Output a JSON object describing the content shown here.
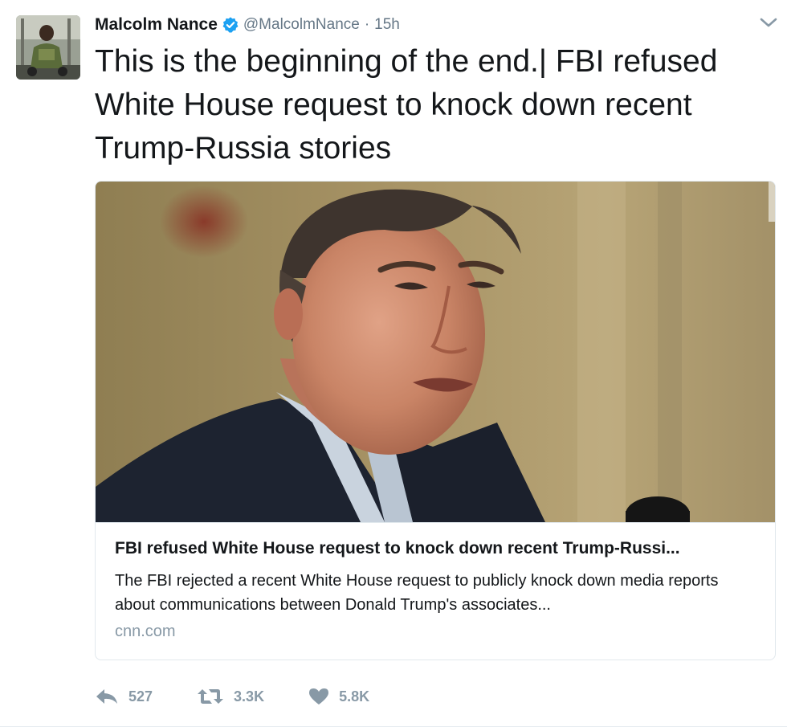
{
  "author": {
    "name": "Malcolm Nance",
    "handle": "@MalcolmNance",
    "separator": "·",
    "time": "15h",
    "verified": true
  },
  "tweet": {
    "text": "This is the beginning of the end.| FBI refused White House request to knock down recent Trump-Russia stories"
  },
  "card": {
    "title": "FBI refused White House request to knock down recent Trump-Russi...",
    "description": "The FBI rejected a recent White House request to publicly knock down media reports about communications between Donald Trump's associates...",
    "domain": "cnn.com"
  },
  "actions": {
    "reply_count": "527",
    "retweet_count": "3.3K",
    "like_count": "5.8K"
  },
  "icons": {
    "caret": "chevron-down-icon",
    "reply": "reply-icon",
    "retweet": "retweet-icon",
    "like": "heart-icon",
    "verified": "verified-badge-icon"
  },
  "colors": {
    "verified_blue": "#1da1f2",
    "secondary_text": "#657786",
    "action_gray": "#8899a6",
    "text": "#14171a"
  }
}
